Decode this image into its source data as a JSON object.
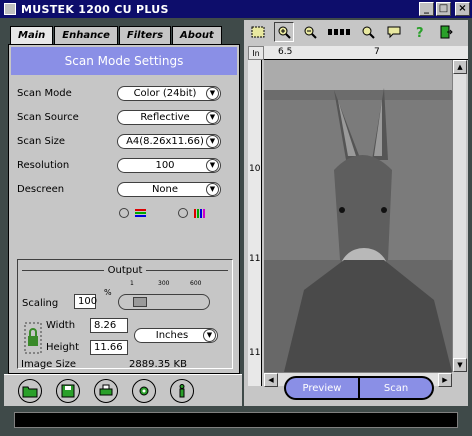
{
  "window": {
    "title": "MUSTEK 1200 CU PLUS",
    "minimize_label": "_",
    "maximize_label": "□",
    "close_label": "×"
  },
  "tabs": [
    {
      "label": "Main",
      "active": true
    },
    {
      "label": "Enhance",
      "active": false
    },
    {
      "label": "Filters",
      "active": false
    },
    {
      "label": "About",
      "active": false
    }
  ],
  "settings": {
    "banner": "Scan Mode Settings",
    "rows": [
      {
        "label": "Scan Mode",
        "value": "Color (24bit)"
      },
      {
        "label": "Scan Source",
        "value": "Reflective"
      },
      {
        "label": "Scan Size",
        "value": "A4(8.26x11.66)"
      },
      {
        "label": "Resolution",
        "value": "100"
      },
      {
        "label": "Descreen",
        "value": "None"
      }
    ]
  },
  "output": {
    "caption": "Output",
    "scaling_label": "Scaling",
    "scaling_value": "100",
    "scaling_unit": "%",
    "slider_ticks": [
      "1",
      "300",
      "600"
    ],
    "width_label": "Width",
    "width_value": "8.26",
    "height_label": "Height",
    "height_value": "11.66",
    "units_value": "Inches",
    "image_size_label": "Image Size",
    "image_size_value": "2889.35 KB"
  },
  "ruler": {
    "unit": "In",
    "h_ticks": [
      "6.5",
      "7"
    ],
    "v_ticks": [
      "10",
      "11",
      "11"
    ]
  },
  "preview": {
    "preview_label": "Preview",
    "scan_label": "Scan"
  },
  "colors": {
    "titlebar": "#0d0d6b",
    "panel": "#c6c6c6",
    "accent": "#8a8fe6",
    "desktop": "#3f4a49"
  }
}
